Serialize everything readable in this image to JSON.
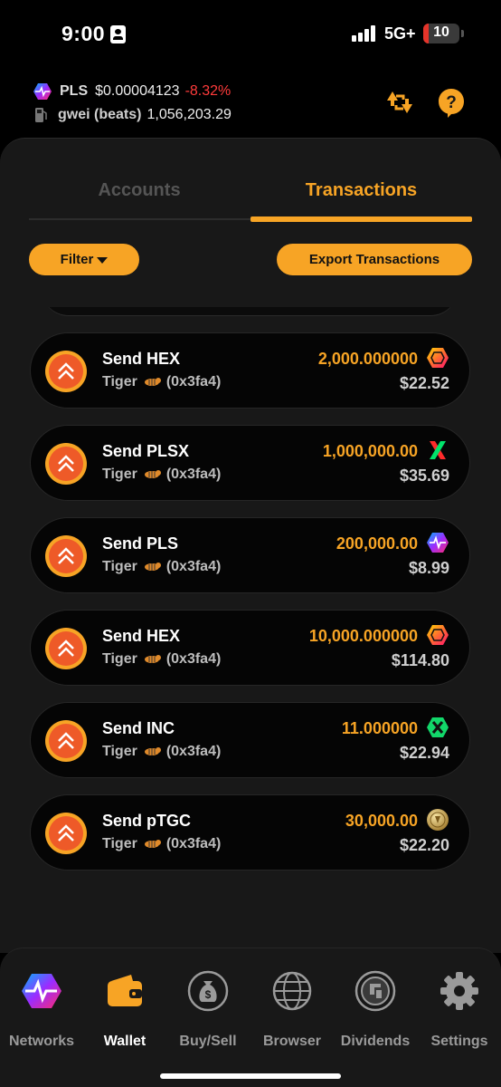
{
  "status_bar": {
    "time": "9:00",
    "network": "5G+",
    "battery": "10"
  },
  "header": {
    "token_symbol": "PLS",
    "token_price": "$0.00004123",
    "token_change": "-8.32%",
    "gas_label": "gwei (beats)",
    "gas_value": "1,056,203.29",
    "colors": {
      "accent": "#f7a425",
      "negative": "#ff3b3b"
    }
  },
  "tabs": [
    {
      "label": "Accounts",
      "active": false
    },
    {
      "label": "Transactions",
      "active": true
    }
  ],
  "toolbar": {
    "filter_label": "Filter",
    "export_label": "Export Transactions"
  },
  "transactions": [
    {
      "title": "Send HEX",
      "account": "Tiger",
      "address": "(0x3fa4)",
      "amount": "2,000.000000",
      "token_icon": "hex-icon",
      "usd": "$22.52"
    },
    {
      "title": "Send PLSX",
      "account": "Tiger",
      "address": "(0x3fa4)",
      "amount": "1,000,000.00",
      "token_icon": "plsx-icon",
      "usd": "$35.69"
    },
    {
      "title": "Send PLS",
      "account": "Tiger",
      "address": "(0x3fa4)",
      "amount": "200,000.00",
      "token_icon": "pls-icon",
      "usd": "$8.99"
    },
    {
      "title": "Send HEX",
      "account": "Tiger",
      "address": "(0x3fa4)",
      "amount": "10,000.000000",
      "token_icon": "hex-icon",
      "usd": "$114.80"
    },
    {
      "title": "Send INC",
      "account": "Tiger",
      "address": "(0x3fa4)",
      "amount": "11.000000",
      "token_icon": "inc-icon",
      "usd": "$22.94"
    },
    {
      "title": "Send pTGC",
      "account": "Tiger",
      "address": "(0x3fa4)",
      "amount": "30,000.00",
      "token_icon": "ptgc-icon",
      "usd": "$22.20"
    }
  ],
  "bottom_nav": [
    {
      "label": "Networks",
      "icon": "pulsechain-icon",
      "active": false
    },
    {
      "label": "Wallet",
      "icon": "wallet-icon",
      "active": true
    },
    {
      "label": "Buy/Sell",
      "icon": "money-bag-icon",
      "active": false
    },
    {
      "label": "Browser",
      "icon": "globe-icon",
      "active": false
    },
    {
      "label": "Dividends",
      "icon": "dividends-icon",
      "active": false
    },
    {
      "label": "Settings",
      "icon": "gear-icon",
      "active": false
    }
  ]
}
